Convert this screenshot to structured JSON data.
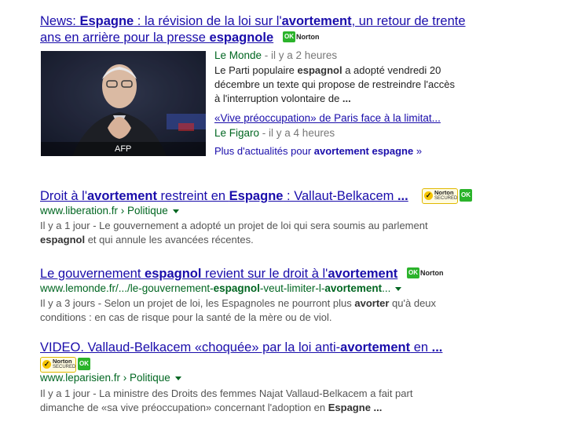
{
  "results": [
    {
      "title_parts": [
        {
          "t": "News: ",
          "b": false
        },
        {
          "t": "Espagne",
          "b": true
        },
        {
          "t": " : la révision de la loi sur l'",
          "b": false
        },
        {
          "t": "avortement",
          "b": true
        },
        {
          "t": ", un retour de trente",
          "b": false
        }
      ],
      "title_line2_parts": [
        {
          "t": "ans en arrière pour la presse ",
          "b": false
        },
        {
          "t": "espagnole",
          "b": true
        }
      ],
      "ok_label": "OK",
      "norton_label": "Norton",
      "image_caption": "AFP",
      "news_source": "Le Monde",
      "news_time": " - il y a 2 heures",
      "snippet_lines": [
        [
          {
            "t": "Le Parti populaire ",
            "b": false
          },
          {
            "t": "espagnol",
            "b": true
          },
          {
            "t": " a adopté vendredi 20",
            "b": false
          }
        ],
        [
          {
            "t": "décembre un texte qui propose de restreindre l'accès",
            "b": false
          }
        ],
        [
          {
            "t": "à l'interruption volontaire de ",
            "b": false
          },
          {
            "t": "...",
            "b": true
          }
        ]
      ],
      "related_title": "«Vive préoccupation» de Paris face à la limitat...",
      "related_source": "Le Figaro",
      "related_time": " - il y a 4 heures",
      "more_parts": [
        {
          "t": "Plus d'actualités pour ",
          "b": false
        },
        {
          "t": "avortement espagne",
          "b": true
        },
        {
          "t": " »",
          "b": false
        }
      ]
    },
    {
      "title_parts": [
        {
          "t": "Droit à l'",
          "b": false
        },
        {
          "t": "avortement",
          "b": true
        },
        {
          "t": " restreint en ",
          "b": false
        },
        {
          "t": "Espagne",
          "b": true
        },
        {
          "t": " : Vallaut-Belkacem ",
          "b": false
        },
        {
          "t": "...",
          "b": true
        }
      ],
      "norton_label": "Norton",
      "norton_sub": "SECURED",
      "ok_label": "OK",
      "url": "www.liberation.fr › Politique",
      "snippet_lines": [
        [
          {
            "t": "Il y a 1 jour - Le gouvernement a adopté un projet de loi qui sera soumis au parlement",
            "b": false
          }
        ],
        [
          {
            "t": "espagnol",
            "b": true
          },
          {
            "t": " et qui annule les avancées récentes.",
            "b": false
          }
        ]
      ]
    },
    {
      "title_parts": [
        {
          "t": "Le gouvernement ",
          "b": false
        },
        {
          "t": "espagnol",
          "b": true
        },
        {
          "t": " revient sur le droit à l'",
          "b": false
        },
        {
          "t": "avortement",
          "b": true
        }
      ],
      "ok_label": "OK",
      "norton_label": "Norton",
      "url_parts": [
        {
          "t": "www.lemonde.fr/.../le-gouvernement-",
          "b": false
        },
        {
          "t": "espagnol",
          "b": true
        },
        {
          "t": "-veut-limiter-l-",
          "b": false
        },
        {
          "t": "avortement",
          "b": true
        },
        {
          "t": "...",
          "b": false
        }
      ],
      "snippet_lines": [
        [
          {
            "t": "Il y a 3 jours - Selon un projet de loi, les Espagnoles ne pourront plus ",
            "b": false
          },
          {
            "t": "avorter",
            "b": true
          },
          {
            "t": " qu'à deux",
            "b": false
          }
        ],
        [
          {
            "t": "conditions : en cas de risque pour la santé de la mère ou de viol.",
            "b": false
          }
        ]
      ]
    },
    {
      "title_parts": [
        {
          "t": "VIDEO. Vallaud-Belkacem «choquée» par la loi anti-",
          "b": false
        },
        {
          "t": "avortement",
          "b": true
        },
        {
          "t": " en ",
          "b": false
        },
        {
          "t": "...",
          "b": true
        }
      ],
      "norton_label": "Norton",
      "norton_sub": "SECURED",
      "ok_label": "OK",
      "url": "www.leparisien.fr › Politique",
      "snippet_lines": [
        [
          {
            "t": "Il y a 1 jour - La ministre des Droits des femmes Najat Vallaud-Belkacem a fait part",
            "b": false
          }
        ],
        [
          {
            "t": "dimanche de «sa vive préoccupation» concernant l'adoption en ",
            "b": false
          },
          {
            "t": "Espagne",
            "b": true
          },
          {
            "t": " ...",
            "b": true
          }
        ]
      ]
    }
  ],
  "colors": {
    "link": "#1a0dab",
    "url": "#006621",
    "snippet": "#545454",
    "ok_green": "#2bb32b"
  }
}
